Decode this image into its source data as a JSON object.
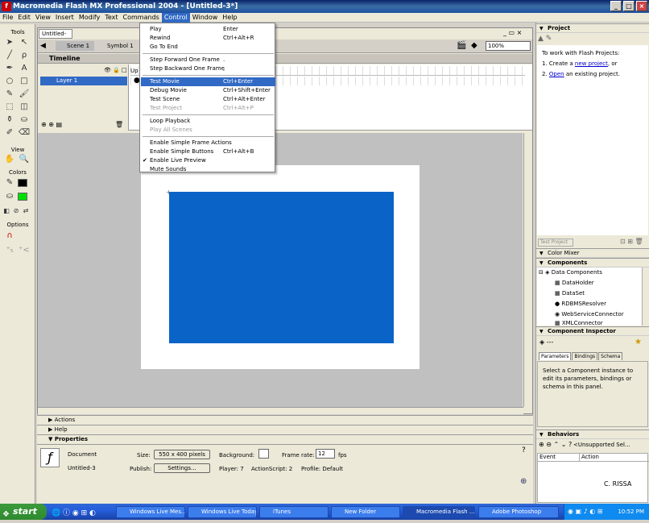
{
  "window": {
    "title": "Macromedia Flash MX Professional 2004 - [Untitled-3*]",
    "app_icon": "flash-icon"
  },
  "menubar": [
    "File",
    "Edit",
    "View",
    "Insert",
    "Modify",
    "Text",
    "Commands",
    "Control",
    "Window",
    "Help"
  ],
  "control_menu": [
    {
      "label": "Play",
      "shortcut": "Enter"
    },
    {
      "label": "Rewind",
      "shortcut": "Ctrl+Alt+R"
    },
    {
      "label": "Go To End",
      "shortcut": ""
    },
    {
      "sep": true
    },
    {
      "label": "Step Forward One Frame",
      "shortcut": "."
    },
    {
      "label": "Step Backward One Frame",
      "shortcut": ","
    },
    {
      "sep": true
    },
    {
      "label": "Test Movie",
      "shortcut": "Ctrl+Enter",
      "highlight": true
    },
    {
      "label": "Debug Movie",
      "shortcut": "Ctrl+Shift+Enter"
    },
    {
      "label": "Test Scene",
      "shortcut": "Ctrl+Alt+Enter"
    },
    {
      "label": "Test Project",
      "shortcut": "Ctrl+Alt+P",
      "disabled": true
    },
    {
      "sep": true
    },
    {
      "label": "Loop Playback",
      "shortcut": ""
    },
    {
      "label": "Play All Scenes",
      "shortcut": "",
      "disabled": true
    },
    {
      "sep": true
    },
    {
      "label": "Enable Simple Frame Actions",
      "shortcut": ""
    },
    {
      "label": "Enable Simple Buttons",
      "shortcut": "Ctrl+Alt+B"
    },
    {
      "label": "Enable Live Preview",
      "shortcut": "",
      "checked": true
    },
    {
      "label": "Mute Sounds",
      "shortcut": ""
    }
  ],
  "tools": {
    "label": "Tools",
    "view": "View",
    "colors": "Colors",
    "options": "Options"
  },
  "document": {
    "tab": "Untitled-3*",
    "scene": "Scene 1",
    "symbol": "Symbol 1",
    "zoom": "100%",
    "timeline": "Timeline",
    "layer": "Layer 1"
  },
  "panels": {
    "actions": "Actions",
    "help": "Help",
    "properties": "Properties"
  },
  "properties": {
    "type": "Document",
    "name": "Untitled-3",
    "size_label": "Size:",
    "size_value": "550 x 400 pixels",
    "background_label": "Background:",
    "framerate_label": "Frame rate:",
    "framerate_value": "12",
    "fps": "fps",
    "publish_label": "Publish:",
    "settings": "Settings...",
    "player": "Player: 7",
    "actionscript": "ActionScript: 2",
    "profile": "Profile: Default"
  },
  "right": {
    "project": "Project",
    "project_intro": "To work with Flash Projects:",
    "step1_pre": "1. Create a ",
    "step1_link": "new project",
    "step1_post": ", or",
    "step2_pre": "2. ",
    "step2_link": "Open",
    "step2_post": " an existing project.",
    "test_project": "Test Project",
    "color_mixer": "Color Mixer",
    "components": "Components",
    "data_components": "Data Components",
    "component_items": [
      "DataHolder",
      "DataSet",
      "RDBMSResolver",
      "WebServiceConnector",
      "XMLConnector"
    ],
    "inspector": "Component Inspector",
    "inspector_dash": "---",
    "inspector_tabs": [
      "Parameters",
      "Bindings",
      "Schema"
    ],
    "inspector_msg": "Select a Component instance to edit its parameters, bindings or schema in this panel.",
    "behaviors": "Behaviors",
    "behaviors_sel": "<Unsupported Sel...",
    "event_col": "Event",
    "action_col": "Action"
  },
  "watermark": "C. RISSA",
  "taskbar": {
    "start": "start",
    "tasks": [
      "Windows Live Mes...",
      "Windows Live Today",
      "iTunes",
      "New Folder",
      "Macromedia Flash ...",
      "Adobe Photoshop"
    ],
    "clock": "10:52 PM"
  },
  "colors": {
    "stage_rect": "#0a64c8",
    "highlight": "#316ac5"
  }
}
